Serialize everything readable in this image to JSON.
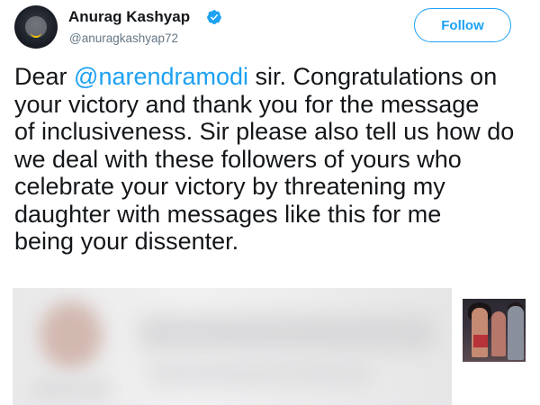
{
  "author": {
    "display_name": "Anurag Kashyap",
    "handle": "@anuragkashyap72",
    "verified_icon": "verified-badge-icon",
    "avatar_icon": "profile-avatar"
  },
  "follow_button": {
    "label": "Follow"
  },
  "tweet": {
    "lines": [
      {
        "before": "Dear ",
        "mention": "@narendramodi",
        "after": " sir. Congratulations on"
      },
      {
        "text": "your victory and thank you for the message"
      },
      {
        "text": "of inclusiveness. Sir please also tell us how do"
      },
      {
        "text": "we deal with these followers of yours who"
      },
      {
        "text": "celebrate your victory by threatening my"
      },
      {
        "text": "daughter with messages like this for me"
      },
      {
        "text": "being your dissenter."
      }
    ]
  },
  "colors": {
    "accent": "#1da1f2",
    "text": "#14171a",
    "secondary_text": "#657786",
    "verified": "#1da1f2"
  }
}
